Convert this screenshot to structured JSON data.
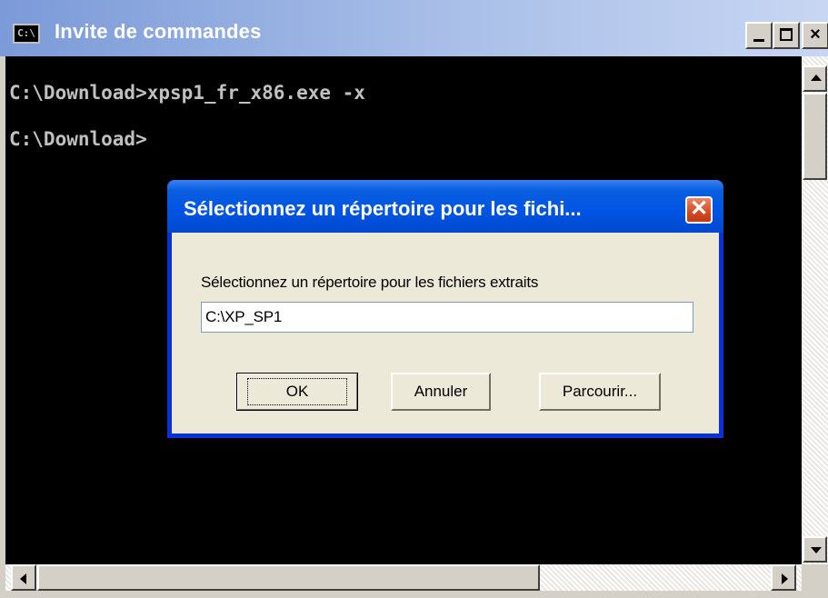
{
  "console": {
    "title": "Invite de commandes",
    "icon": "C:\\",
    "lines": [
      "C:\\Download>xpsp1_fr_x86.exe -x",
      "C:\\Download>"
    ],
    "colors": {
      "background": "#000000",
      "text": "#c0c0c0"
    }
  },
  "dialog": {
    "title": "Sélectionnez un répertoire pour les fichi...",
    "label": "Sélectionnez un répertoire pour les fichiers extraits",
    "path_value": "C:\\XP_SP1",
    "ok_label": "OK",
    "cancel_label": "Annuler",
    "browse_label": "Parcourir...",
    "close_glyph": "✕"
  },
  "icons": [
    "console-icon",
    "minimize-icon",
    "maximize-icon",
    "close-icon",
    "arrow-up-icon",
    "arrow-down-icon",
    "arrow-left-icon",
    "arrow-right-icon"
  ]
}
